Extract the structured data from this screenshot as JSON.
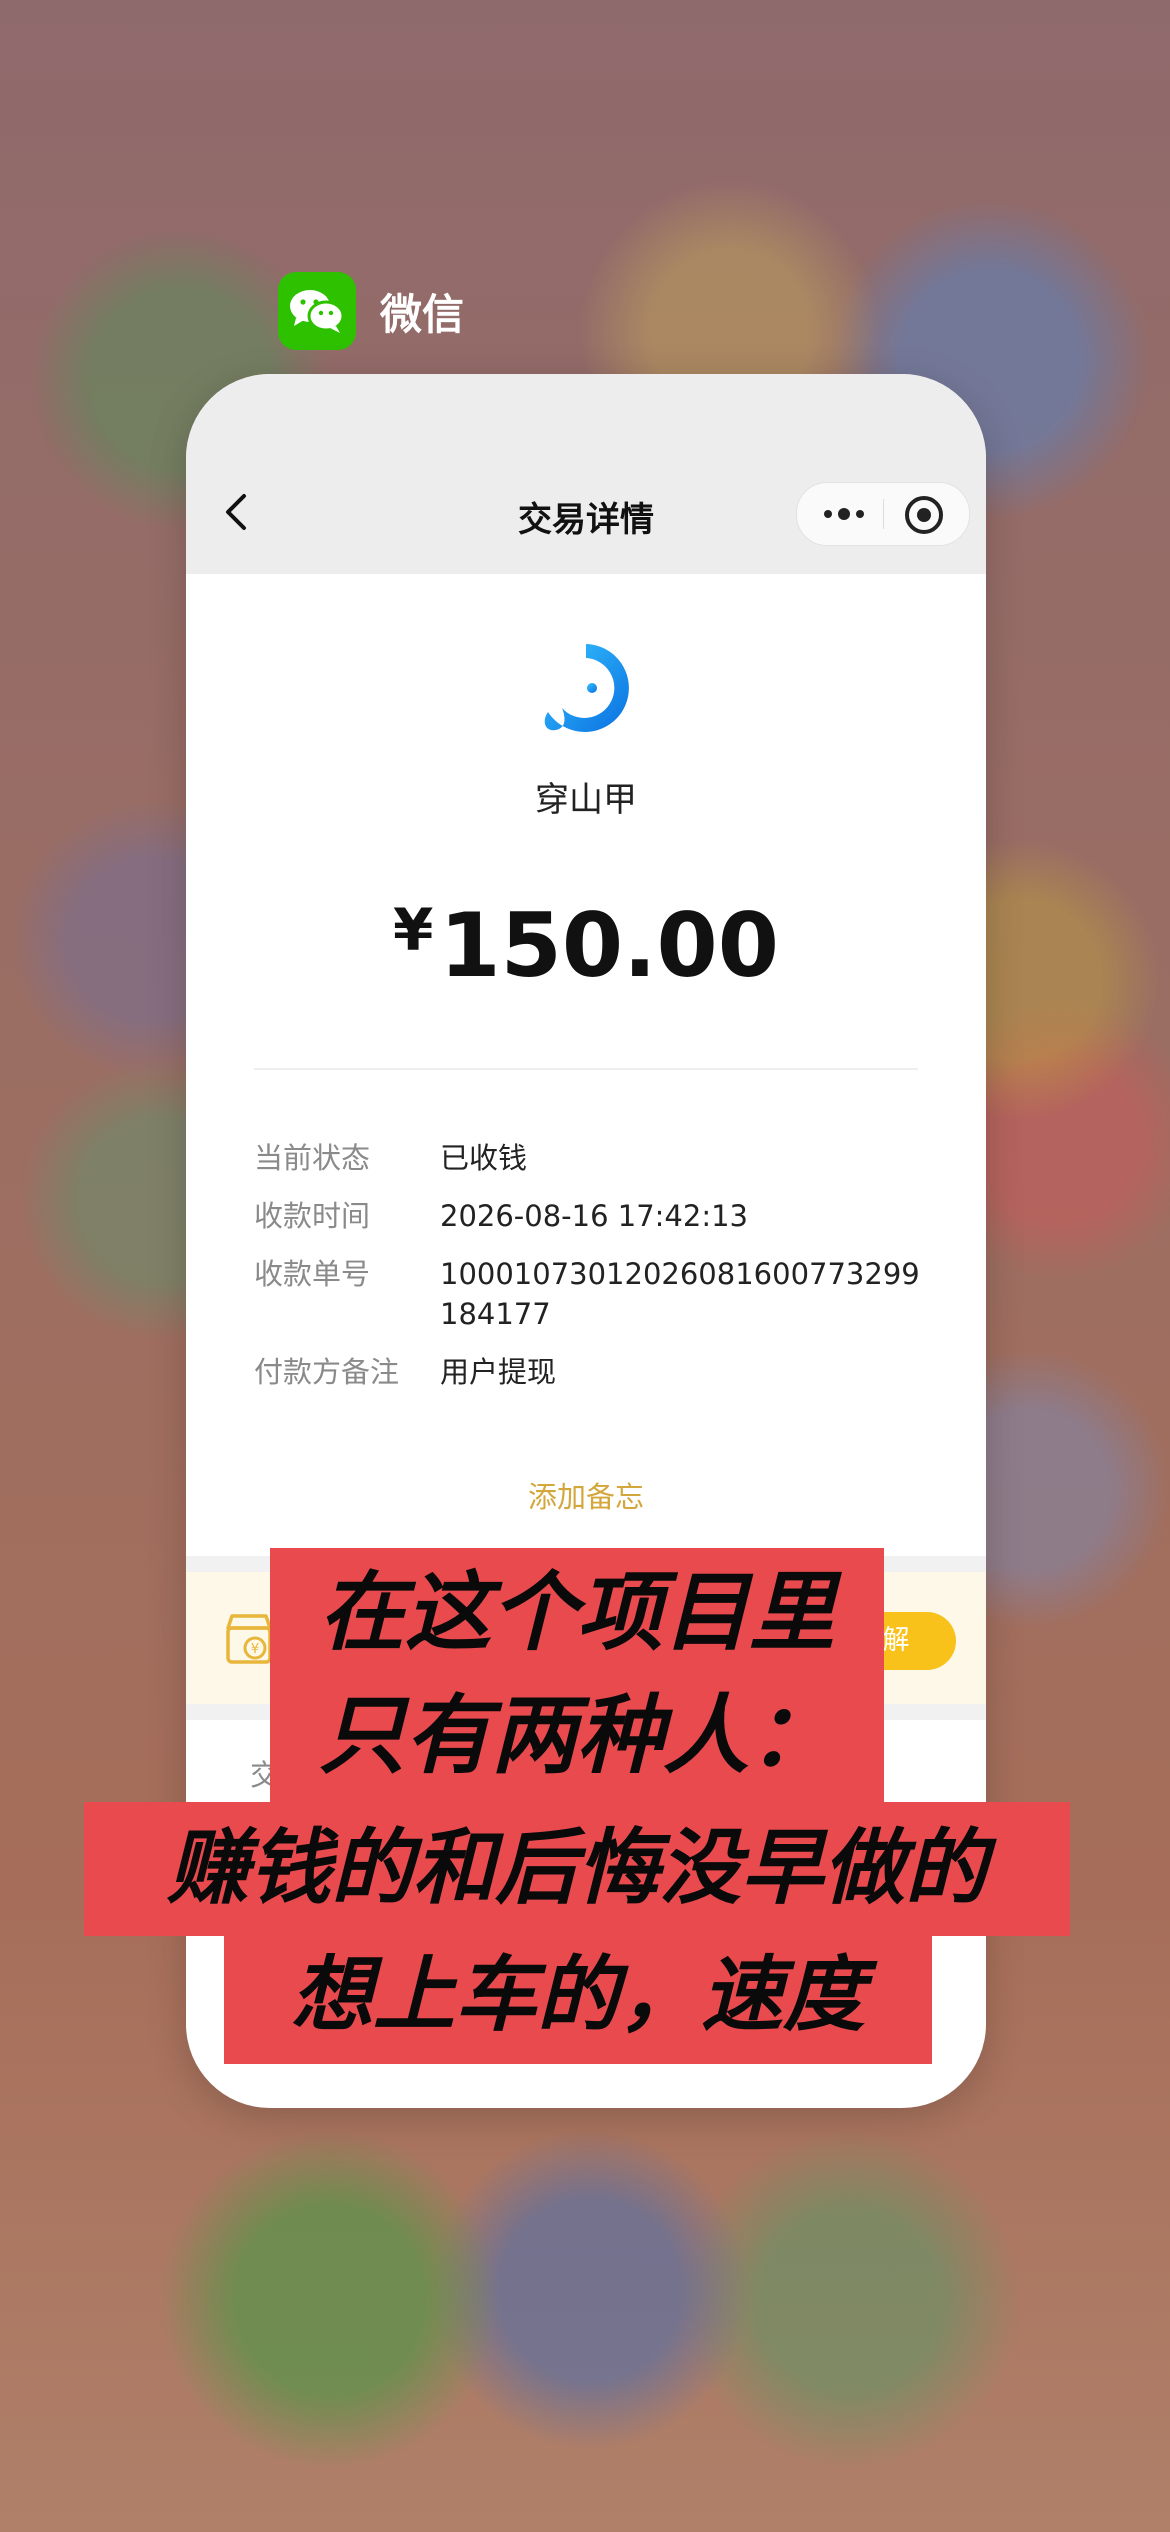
{
  "app": {
    "name": "微信",
    "icon": "wechat-icon"
  },
  "nav": {
    "title": "交易详情",
    "back_icon": "chevron-left-icon",
    "more_icon": "more-dots-icon",
    "close_icon": "record-circle-icon"
  },
  "transaction": {
    "merchant": "穿山甲",
    "currency": "¥",
    "amount": "150.00",
    "rows": [
      {
        "label": "当前状态",
        "value": "已收钱"
      },
      {
        "label": "收款时间",
        "value": "2026-08-16 17:42:13"
      },
      {
        "label": "收款单号",
        "value": "10001073012026081600773299184177"
      },
      {
        "label": "付款方备注",
        "value": "用户提现"
      }
    ],
    "add_memo": "添加备忘"
  },
  "banner": {
    "icon": "shop-coin-icon",
    "button_label": "解"
  },
  "partial_label": "交",
  "caption": {
    "line1": "在这个项目里",
    "line2": "只有两种人：",
    "line3": "赚钱的和后悔没早做的",
    "line4": "想上车的，速度"
  },
  "colors": {
    "accent_gold": "#d4a73c",
    "banner_button": "#f8c21b",
    "caption_bg": "#e84a4e",
    "wechat_green": "#2dc100"
  }
}
